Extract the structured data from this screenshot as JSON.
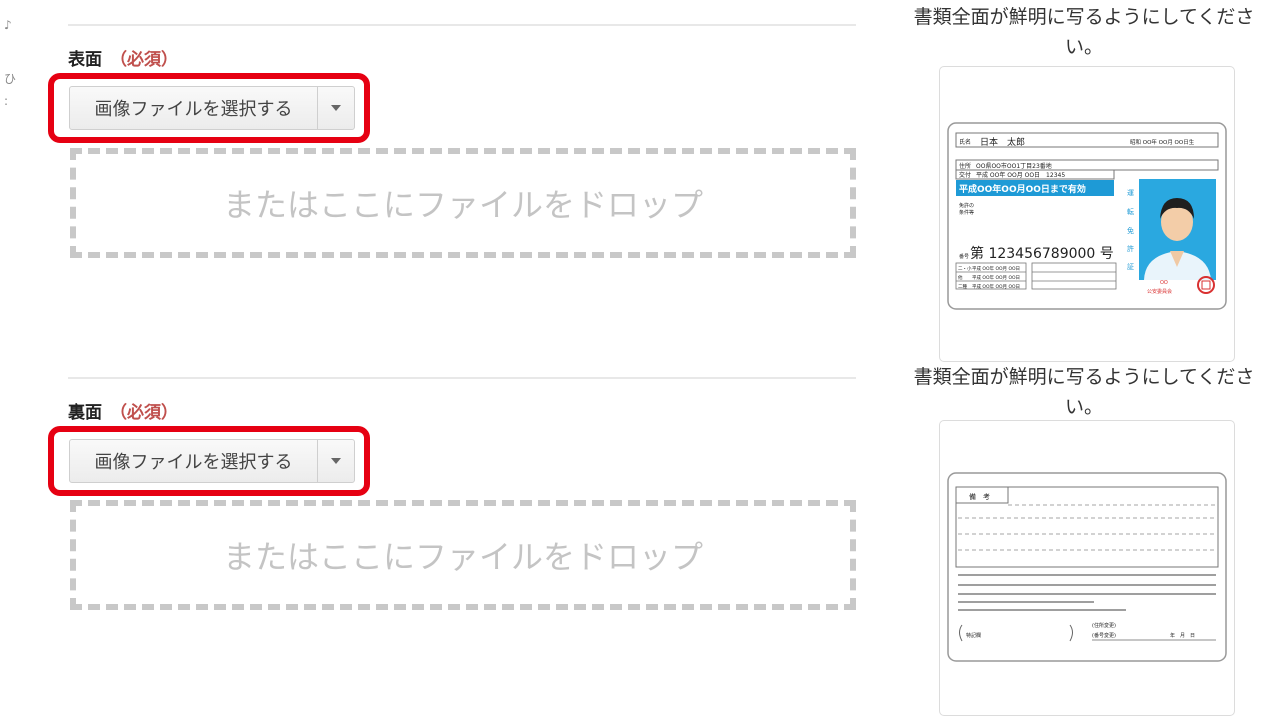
{
  "left_edge_glyphs": [
    "♪",
    "ひ",
    ":"
  ],
  "front": {
    "label": "表面",
    "required": "（必須）",
    "select_button": "画像ファイルを選択する",
    "dropzone": "またはここにファイルをドロップ"
  },
  "back": {
    "label": "裏面",
    "required": "（必須）",
    "select_button": "画像ファイルを選択する",
    "dropzone": "またはここにファイルをドロップ"
  },
  "help": {
    "top_line1": "書類全面が鮮明に写るようにしてくださ",
    "top_line2": "い。",
    "bottom_line1": "書類全面が鮮明に写るようにしてくださ",
    "bottom_line2": "い。"
  },
  "license_front": {
    "name_label": "氏名",
    "name": "日本　太郎",
    "birth": "昭和 OO年 OO月 OO日生",
    "address_label": "住所",
    "address": "OO県OO市OO1丁目23番地",
    "issue_label": "交付",
    "issue": "平成 OO年 OO月 OO日　12345",
    "validity": "平成OO年OO月OO日まで有効",
    "conditions_label1": "免許の",
    "conditions_label2": "条件等",
    "vertical_label": [
      "運",
      "転",
      "免",
      "許",
      "証"
    ],
    "number_label": "番号",
    "number": "第 123456789000 号",
    "history_labels": [
      "二・小",
      "他",
      "二種"
    ],
    "history_date": "平成 OO年 OO月 OO日",
    "issuer_small": "OO",
    "issuer": "公安委員会"
  },
  "license_back": {
    "remarks_label": "備　考",
    "address_change_label": "(住所変更)",
    "record_label": "(番号変更)",
    "record_date": "年　月　日",
    "special_label": "特記欄"
  },
  "colors": {
    "required": "#c0504d",
    "highlight": "#e60012",
    "validity_band": "#1e9ad6",
    "photo_bg": "#2aa8e0"
  },
  "icons": {
    "dropdown": "caret-down-icon"
  }
}
